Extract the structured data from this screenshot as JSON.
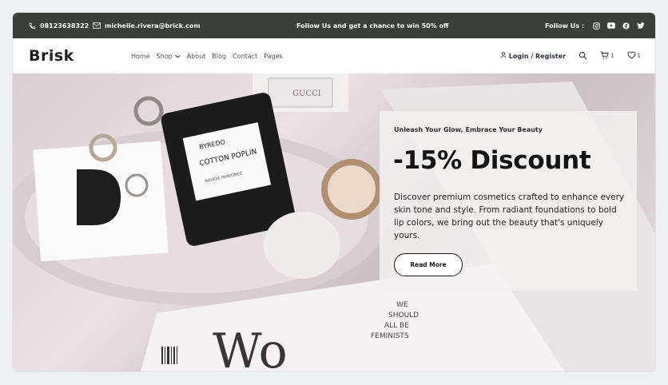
{
  "topbar": {
    "phone": "08123638322",
    "email": "michelle.rivera@brick.com",
    "promo": "Follow Us  and get a chance to win 50% off",
    "follow_label": "Follow Us :"
  },
  "nav": {
    "logo": "Brisk",
    "menu": [
      "Home",
      "Shop",
      "About",
      "Blog",
      "Contact",
      "Pages"
    ],
    "login": "Login / Register",
    "cart_count": "1",
    "wishlist_count": "1"
  },
  "hero": {
    "kicker": "Unleash Your Glow, Embrace Your Beauty",
    "headline": "-15% Discount",
    "description": "Discover premium cosmetics crafted to enhance every skin tone and style. From radiant foundations to bold lip colors, we bring out the beauty that's uniquely yours.",
    "cta": "Read More",
    "image_text": {
      "candle_brand": "BYREDO",
      "candle_name": "COTTON POPLIN",
      "candle_sub": "BOUGIE PARFUMÉE",
      "box_label": "GUCCI",
      "mag_line1": "WE",
      "mag_line2": "SHOULD",
      "mag_line3": "ALL BE",
      "mag_line4": "FEMINISTS"
    }
  },
  "icons": {
    "phone": "phone-icon",
    "email": "envelope-icon",
    "instagram": "instagram-icon",
    "youtube": "youtube-icon",
    "facebook": "facebook-icon",
    "twitter": "twitter-icon",
    "user": "user-icon",
    "search": "search-icon",
    "cart": "cart-icon",
    "heart": "heart-icon"
  },
  "colors": {
    "topbar_bg": "#3b3e3b",
    "text_dark": "#141414",
    "card_bg": "#f2f0f0"
  }
}
